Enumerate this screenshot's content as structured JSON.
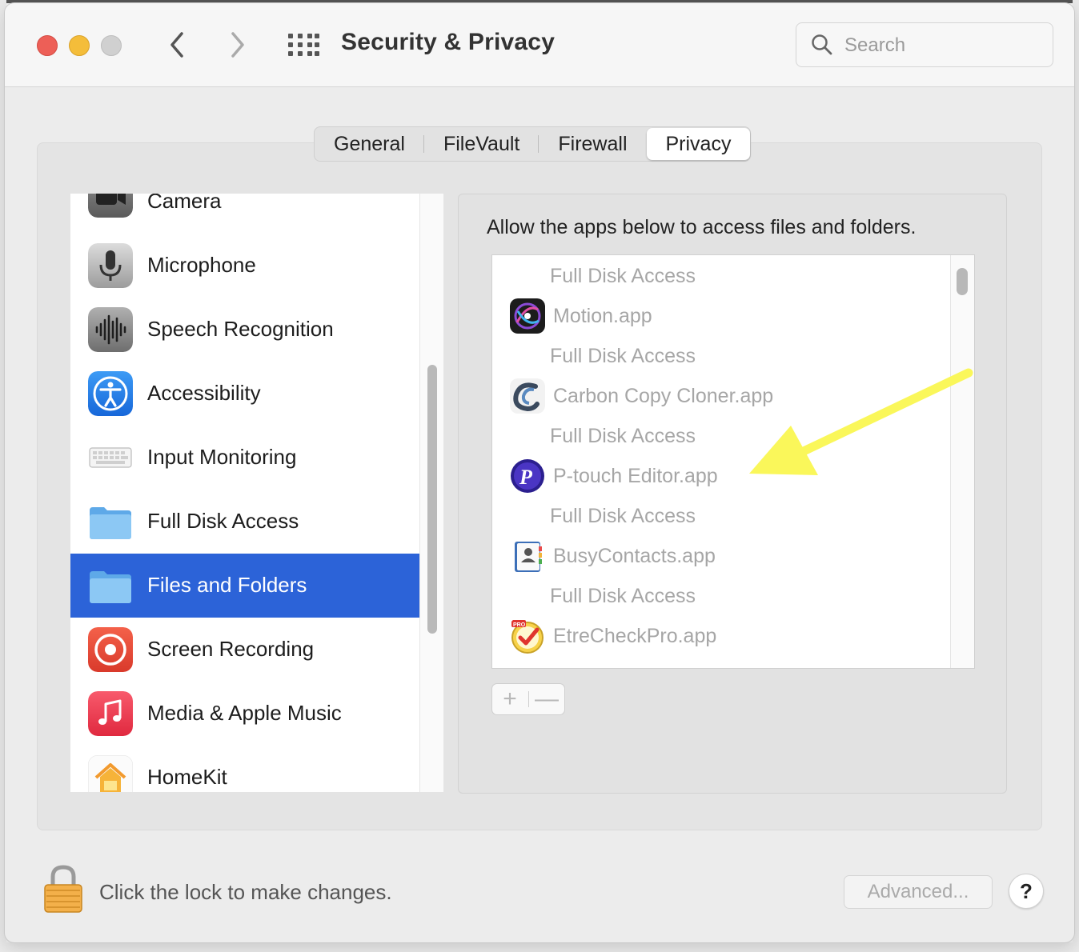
{
  "window": {
    "title": "Security & Privacy",
    "search_placeholder": "Search"
  },
  "tabs": [
    {
      "label": "General",
      "active": false
    },
    {
      "label": "FileVault",
      "active": false
    },
    {
      "label": "Firewall",
      "active": false
    },
    {
      "label": "Privacy",
      "active": true
    }
  ],
  "sidebar": {
    "items": [
      {
        "label": "Camera",
        "icon": "camera-icon"
      },
      {
        "label": "Microphone",
        "icon": "microphone-icon"
      },
      {
        "label": "Speech Recognition",
        "icon": "waveform-icon"
      },
      {
        "label": "Accessibility",
        "icon": "accessibility-icon"
      },
      {
        "label": "Input Monitoring",
        "icon": "keyboard-icon"
      },
      {
        "label": "Full Disk Access",
        "icon": "folder-icon"
      },
      {
        "label": "Files and Folders",
        "icon": "folder-icon",
        "selected": true
      },
      {
        "label": "Screen Recording",
        "icon": "record-icon"
      },
      {
        "label": "Media & Apple Music",
        "icon": "music-note-icon"
      },
      {
        "label": "HomeKit",
        "icon": "home-icon"
      }
    ]
  },
  "panel": {
    "heading": "Allow the apps below to access files and folders.",
    "apps": [
      {
        "name": "Motion.app",
        "access": "Full Disk Access",
        "icon": "motion-app-icon"
      },
      {
        "name": "Carbon Copy Cloner.app",
        "access": "Full Disk Access",
        "icon": "ccc-app-icon"
      },
      {
        "name": "P-touch Editor.app",
        "access": "Full Disk Access",
        "icon": "ptouch-app-icon"
      },
      {
        "name": "BusyContacts.app",
        "access": "Full Disk Access",
        "icon": "busycontacts-app-icon"
      },
      {
        "name": "EtreCheckPro.app",
        "access": "Full Disk Access",
        "icon": "etrecheck-app-icon"
      }
    ],
    "top_sub": "Full Disk Access",
    "add_label": "+",
    "remove_label": "—"
  },
  "footer": {
    "lock_text": "Click the lock to make changes.",
    "advanced_label": "Advanced...",
    "help_label": "?"
  },
  "colors": {
    "selection": "#2c63d8",
    "annotation_arrow": "#faf75a"
  }
}
